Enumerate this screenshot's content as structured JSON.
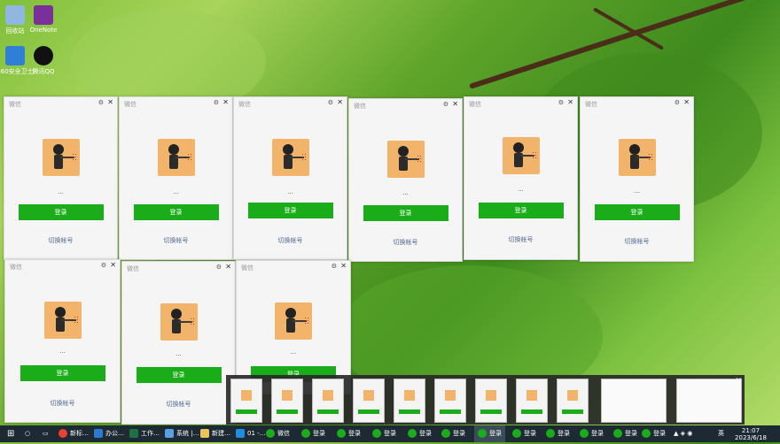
{
  "desktop": {
    "icons": [
      {
        "label": "回收站",
        "icon": "recycle-bin-icon",
        "color": "#8fb7e0"
      },
      {
        "label": "OneNote",
        "icon": "onenote-icon",
        "color": "#7a2f9a"
      },
      {
        "label": "360安全卫士",
        "icon": "security-icon",
        "color": "#2f7fd6"
      },
      {
        "label": "腾讯QQ",
        "icon": "qq-penguin-icon",
        "color": "#111111"
      }
    ]
  },
  "wechat": {
    "title": "微信",
    "login_label": "登录",
    "switch_label": "切换帐号",
    "names": [
      "···",
      "···",
      "···",
      "···",
      "···",
      "···",
      "···",
      "···",
      "···"
    ],
    "accent": "#1aad19"
  },
  "taskbar": {
    "items": [
      "新标…",
      "办公…",
      "工作…",
      "系统 |…",
      "新建…",
      "01 -…",
      "微信",
      "登录",
      "登录",
      "登录",
      "登录",
      "登录",
      "登录",
      "登录",
      "登录",
      "登录",
      "登录",
      "登录"
    ],
    "clock_time": "21:07",
    "clock_date": "2023/6/18",
    "lang": "英"
  }
}
